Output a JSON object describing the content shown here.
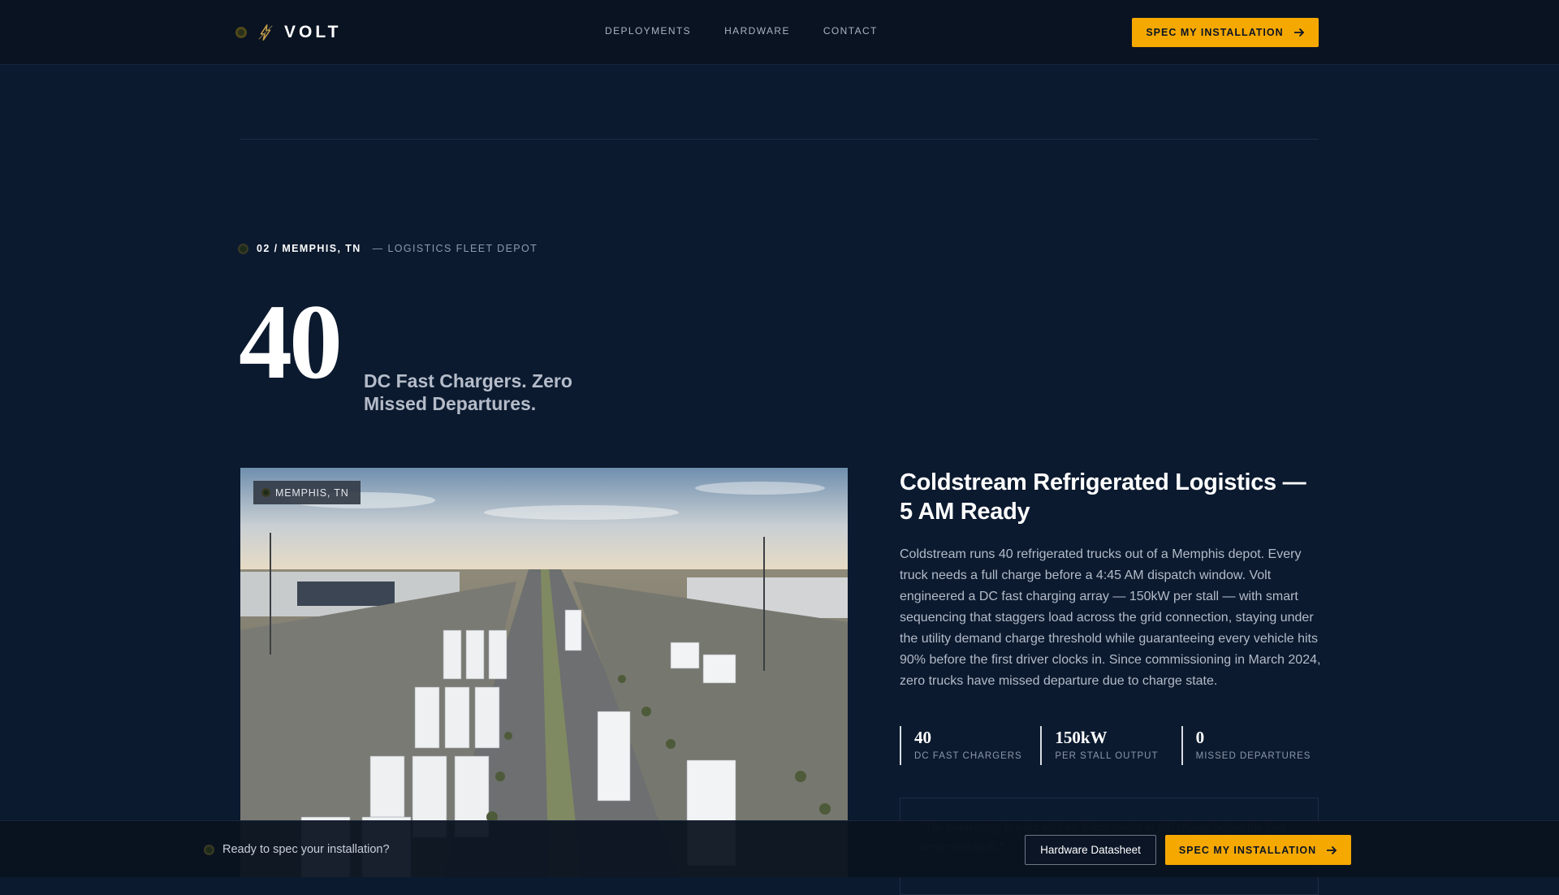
{
  "brand": {
    "name": "VOLT"
  },
  "nav": {
    "links": [
      "DEPLOYMENTS",
      "HARDWARE",
      "CONTACT"
    ],
    "cta_label": "SPEC MY INSTALLATION"
  },
  "eyebrow": {
    "index_location": "02 / MEMPHIS, TN",
    "category": "— LOGISTICS FLEET DEPOT"
  },
  "hero": {
    "number": "40",
    "caption": "DC Fast Chargers. Zero Missed Departures."
  },
  "photo": {
    "badge": "MEMPHIS, TN",
    "description": "Aerial photo of a logistics depot with rows of white refrigerated trucks"
  },
  "case": {
    "title": "Coldstream Refrigerated Logistics — 5 AM Ready",
    "body": "Coldstream runs 40 refrigerated trucks out of a Memphis depot. Every truck needs a full charge before a 4:45 AM dispatch window. Volt engineered a DC fast charging array — 150kW per stall — with smart sequencing that staggers load across the grid connection, staying under the utility demand charge threshold while guaranteeing every vehicle hits 90% before the first driver clocks in. Since commissioning in March 2024, zero trucks have missed departure due to charge state.",
    "stats": [
      {
        "value": "40",
        "label": "DC FAST CHARGERS"
      },
      {
        "value": "150kW",
        "label": "PER STALL OUTPUT"
      },
      {
        "value": "0",
        "label": "MISSED DEPARTURES"
      }
    ],
    "quote": "\"The sequencing is what sold us. Forty trucks at full charge before the first driver clocks in.\""
  },
  "cta_bar": {
    "text": "Ready to spec your installation?",
    "secondary_label": "Hardware Datasheet",
    "primary_label": "SPEC MY INSTALLATION"
  },
  "colors": {
    "background": "#0b1a2f",
    "nav_background": "#0a1322",
    "accent": "#f5a800",
    "text_primary": "#ffffff",
    "text_muted": "#b3bbc8"
  }
}
